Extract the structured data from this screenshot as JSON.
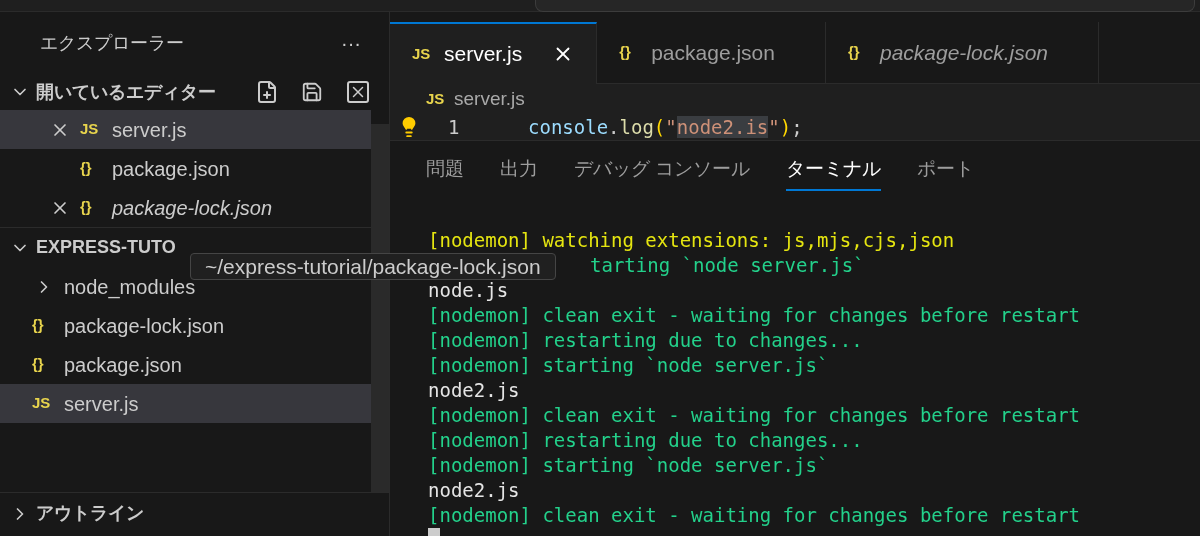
{
  "sidebar": {
    "title": "エクスプローラー",
    "more": "···",
    "open_editors": {
      "title": "開いているエディター",
      "expanded": true,
      "items": [
        {
          "name": "server.js",
          "icon": "JS",
          "selected": true,
          "closable": true,
          "italic": false
        },
        {
          "name": "package.json",
          "icon": "{}",
          "selected": false,
          "closable": false,
          "italic": false
        },
        {
          "name": "package-lock.json",
          "icon": "{}",
          "selected": false,
          "closable": true,
          "italic": true
        }
      ]
    },
    "project": {
      "title": "EXPRESS-TUTO",
      "expanded": true,
      "items": [
        {
          "name": "node_modules",
          "kind": "folder",
          "selected": false
        },
        {
          "name": "package-lock.json",
          "kind": "file",
          "icon": "{}",
          "selected": false
        },
        {
          "name": "package.json",
          "kind": "file",
          "icon": "{}",
          "selected": false
        },
        {
          "name": "server.js",
          "kind": "file",
          "icon": "JS",
          "selected": true
        }
      ]
    },
    "outline": {
      "title": "アウトライン",
      "expanded": false
    }
  },
  "tooltip": "~/express-tutorial/package-lock.json",
  "tabs": [
    {
      "name": "server.js",
      "icon": "JS",
      "selected": true,
      "italic": false
    },
    {
      "name": "package.json",
      "icon": "{}",
      "selected": false,
      "italic": false
    },
    {
      "name": "package-lock.json",
      "icon": "{}",
      "selected": false,
      "italic": true
    }
  ],
  "breadcrumb": {
    "name": "server.js",
    "icon": "JS"
  },
  "code": {
    "line_number": "1",
    "tokens": [
      {
        "text": "console",
        "kind": "variable"
      },
      {
        "text": ".",
        "kind": "plain"
      },
      {
        "text": "log",
        "kind": "function"
      },
      {
        "text": "(",
        "kind": "bracket"
      },
      {
        "text": "\"",
        "kind": "string"
      },
      {
        "text": "node2.is",
        "kind": "highlighted-string"
      },
      {
        "text": "\"",
        "kind": "string"
      },
      {
        "text": ")",
        "kind": "bracket"
      },
      {
        "text": ";",
        "kind": "plain"
      }
    ]
  },
  "panel_tabs": [
    {
      "label": "問題",
      "selected": false
    },
    {
      "label": "出力",
      "selected": false
    },
    {
      "label": "デバッグ コンソール",
      "selected": false
    },
    {
      "label": "ターミナル",
      "selected": true
    },
    {
      "label": "ポート",
      "selected": false
    }
  ],
  "terminal": [
    {
      "text": "[nodemon] watching extensions: js,mjs,cjs,json",
      "kind": "warn"
    },
    {
      "text": "tarting `node server.js`",
      "kind": "info-covered"
    },
    {
      "text": "node.js",
      "kind": "output"
    },
    {
      "text": "[nodemon] clean exit - waiting for changes before restart",
      "kind": "info"
    },
    {
      "text": "[nodemon] restarting due to changes...",
      "kind": "info"
    },
    {
      "text": "[nodemon] starting `node server.js`",
      "kind": "info"
    },
    {
      "text": "node2.js",
      "kind": "output"
    },
    {
      "text": "[nodemon] clean exit - waiting for changes before restart",
      "kind": "info"
    },
    {
      "text": "[nodemon] restarting due to changes...",
      "kind": "info"
    },
    {
      "text": "[nodemon] starting `node server.js`",
      "kind": "info"
    },
    {
      "text": "node2.js",
      "kind": "output"
    },
    {
      "text": "[nodemon] clean exit - waiting for changes before restart",
      "kind": "info"
    }
  ]
}
